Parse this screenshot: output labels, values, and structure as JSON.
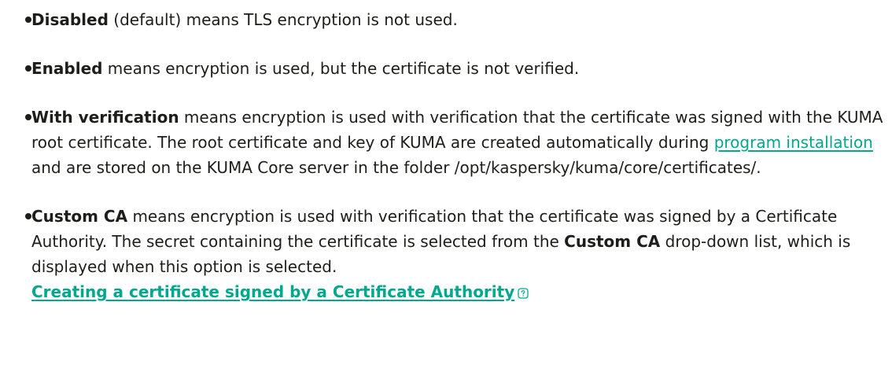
{
  "options": [
    {
      "term": "Disabled",
      "text": " (default) means TLS encryption is not used."
    },
    {
      "term": "Enabled",
      "text": " means encryption is used, but the certificate is not verified."
    },
    {
      "term": "With verification",
      "text_1": " means encryption is used with verification that the certificate was signed with the KUMA root certificate. The root certificate and key of KUMA are created automatically during ",
      "link": "program installation",
      "text_2": " and are stored on the KUMA Core server in the folder /opt/kaspersky/kuma/core/certificates/."
    },
    {
      "term": "Custom CA",
      "text_1": " means encryption is used with verification that the certificate was signed by a Certificate Authority. The secret containing the certificate is selected from the ",
      "term_2": "Custom CA",
      "text_2": " drop-down list, which is displayed when this option is selected.",
      "link": "Creating a certificate signed by a Certificate Authority",
      "link_icon": "help-icon"
    }
  ],
  "colors": {
    "text": "#1d1d1b",
    "link": "#00a88e"
  }
}
